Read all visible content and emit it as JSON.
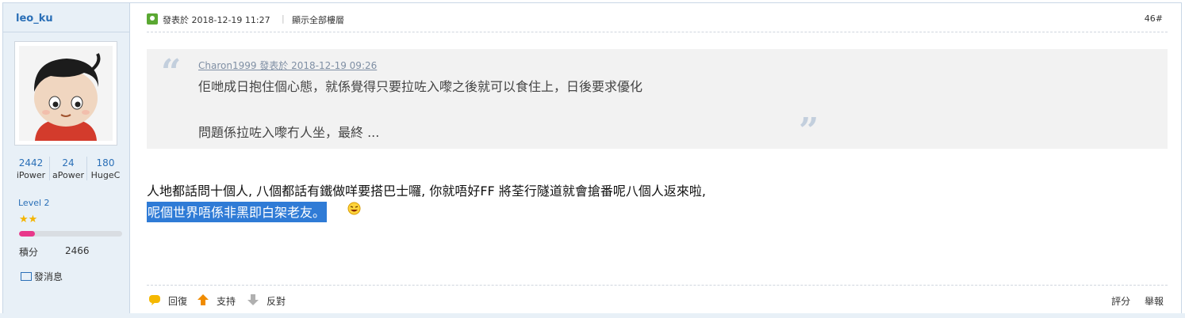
{
  "author": {
    "username": "leo_ku",
    "stats": [
      {
        "value": "2442",
        "label": "iPower"
      },
      {
        "value": "24",
        "label": "aPower"
      },
      {
        "value": "180",
        "label": "HugeC"
      }
    ],
    "level": "Level 2",
    "stars": "★★",
    "level_progress": 0.15,
    "score_label": "積分",
    "score_value": "2466",
    "pm_label": "發消息"
  },
  "post": {
    "posted_at": "發表於 2018-12-19 11:27",
    "show_all": "顯示全部樓層",
    "floor": "46#",
    "quote": {
      "header": "Charon1999 發表於 2018-12-19 09:26",
      "line1": "佢哋成日抱住個心態，就係覺得只要拉咗入嚟之後就可以食住上，日後要求優化",
      "line2": "問題係拉咗入嚟冇人坐，最終 ..."
    },
    "body_line1": "人地都話問十個人, 八個都話有鐵做咩要搭巴士囉, 你就唔好FF 將荃行隧道就會搶番呢八個人返來啦,",
    "body_line2": "呢個世界唔係非黑即白架老友。"
  },
  "footer": {
    "reply": "回復",
    "support": "支持",
    "oppose": "反對",
    "rate": "評分",
    "report": "舉報"
  },
  "colors": {
    "link_blue": "#2a6fb7",
    "sidebar_bg": "#e8f0f7",
    "selection_blue": "#2f7bd6",
    "progress_pink": "#e8388b"
  }
}
